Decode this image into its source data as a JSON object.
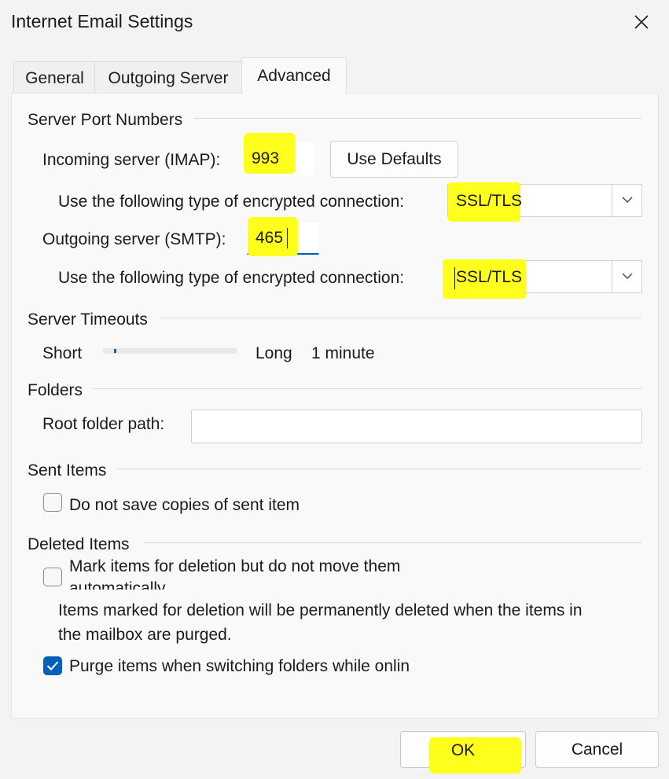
{
  "window": {
    "title": "Internet Email Settings"
  },
  "tabs": [
    {
      "label": "General"
    },
    {
      "label": "Outgoing Server"
    },
    {
      "label": "Advanced"
    }
  ],
  "active_tab": "Advanced",
  "server_ports": {
    "heading": "Server Port Numbers",
    "incoming_label": "Incoming server (IMAP):",
    "incoming_value": "993",
    "use_defaults_label": "Use Defaults",
    "incoming_encryption_label": "Use the following type of encrypted connection:",
    "incoming_encryption_value": "SSL/TLS",
    "outgoing_label": "Outgoing server (SMTP):",
    "outgoing_value": "465",
    "outgoing_encryption_label": "Use the following type of encrypted connection:",
    "outgoing_encryption_value": "SSL/TLS"
  },
  "timeouts": {
    "heading": "Server Timeouts",
    "short_label": "Short",
    "long_label": "Long",
    "value_label": "1 minute",
    "slider_fraction": 0.05
  },
  "folders": {
    "heading": "Folders",
    "root_label": "Root folder path:",
    "root_value": ""
  },
  "sent_items": {
    "heading": "Sent Items",
    "no_save_label": "Do not save copies of sent item",
    "no_save_checked": false
  },
  "deleted_items": {
    "heading": "Deleted Items",
    "mark_label_line1": "Mark items for deletion but do not move them",
    "mark_label_line2": "automatically",
    "mark_checked": false,
    "note_line1": "Items marked for deletion will be permanently deleted when the items in",
    "note_line2": "the mailbox are purged.",
    "purge_label": "Purge items when switching folders while onlin",
    "purge_checked": true
  },
  "footer": {
    "ok_label": "OK",
    "cancel_label": "Cancel"
  },
  "colors": {
    "highlight": "#ffff1e",
    "accent": "#005fb8"
  }
}
